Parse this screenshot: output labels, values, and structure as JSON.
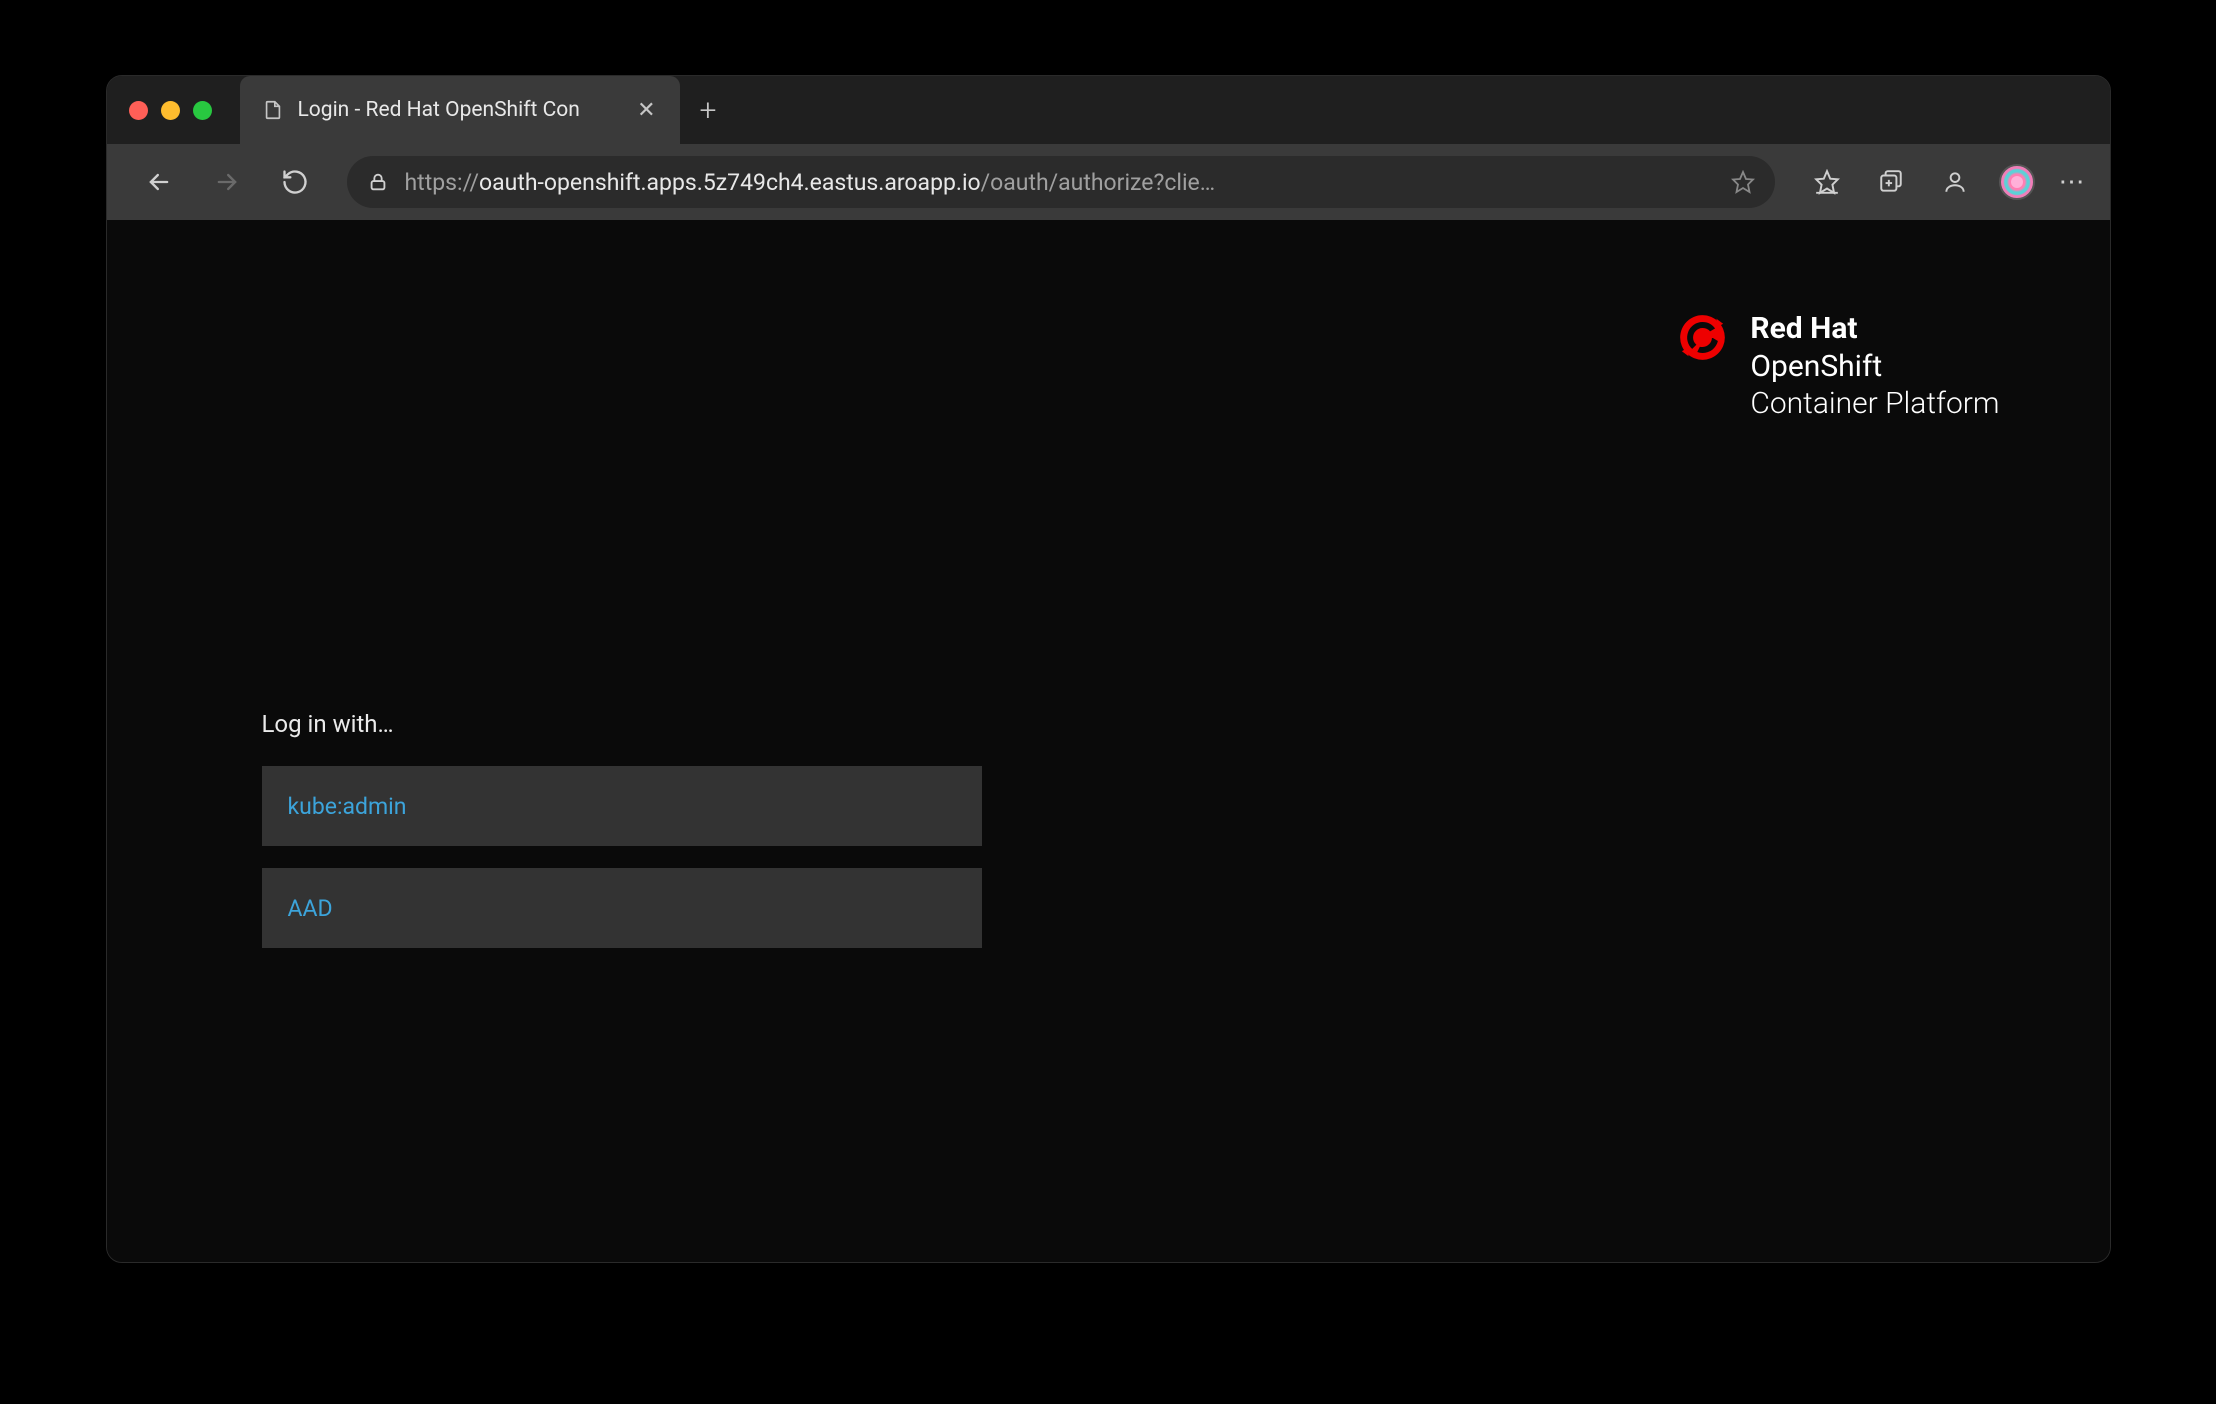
{
  "browser": {
    "tab": {
      "title": "Login - Red Hat OpenShift Con"
    },
    "url": {
      "scheme": "https://",
      "host": "oauth-openshift.apps.5z749ch4.eastus.aroapp.io",
      "path": "/oauth/authorize?clie…"
    }
  },
  "logo": {
    "line1": "Red Hat",
    "line2": "OpenShift",
    "line3": "Container Platform"
  },
  "login": {
    "heading": "Log in with…",
    "providers": [
      {
        "label": "kube:admin"
      },
      {
        "label": "AAD"
      }
    ]
  }
}
